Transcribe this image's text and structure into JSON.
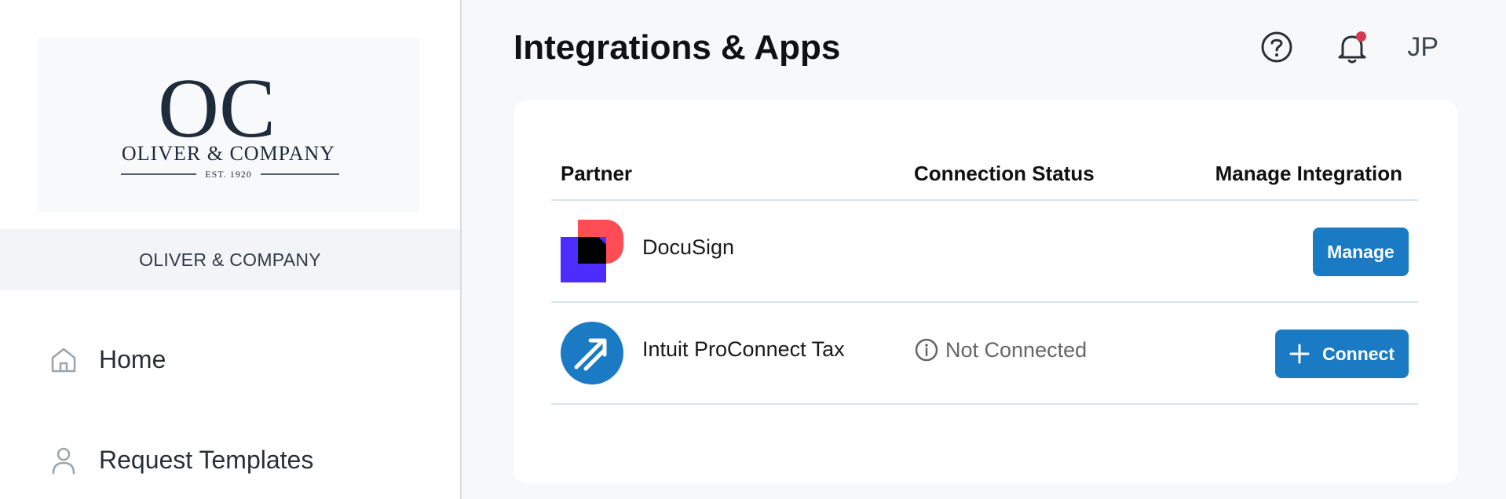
{
  "sidebar": {
    "logo": {
      "monogram": "OC",
      "wordmark": "OLIVER & COMPANY",
      "tagline": "EST. 1920"
    },
    "org_name": "OLIVER & COMPANY",
    "nav": [
      {
        "label": "Home",
        "icon": "home-icon"
      },
      {
        "label": "Request Templates",
        "icon": "user-icon"
      }
    ]
  },
  "header": {
    "title": "Integrations & Apps",
    "help_icon": "help-circle-icon",
    "notification_icon": "bell-icon",
    "avatar_initials": "JP"
  },
  "table": {
    "columns": [
      "Partner",
      "Connection Status",
      "Manage Integration"
    ],
    "rows": [
      {
        "partner": "DocuSign",
        "logo": "docusign-logo",
        "status": "",
        "action": "Manage"
      },
      {
        "partner": "Intuit ProConnect Tax",
        "logo": "intuit-proconnect-logo",
        "status": "Not Connected",
        "status_icon": "info-icon",
        "action": "Connect",
        "action_icon": "plus-icon"
      }
    ]
  },
  "colors": {
    "primary_button": "#1a7ac4",
    "notification_dot": "#d43a4f",
    "docusign_red": "#ff4d55",
    "docusign_blue": "#4c2cff",
    "intuit_blue": "#1a7ac4"
  }
}
